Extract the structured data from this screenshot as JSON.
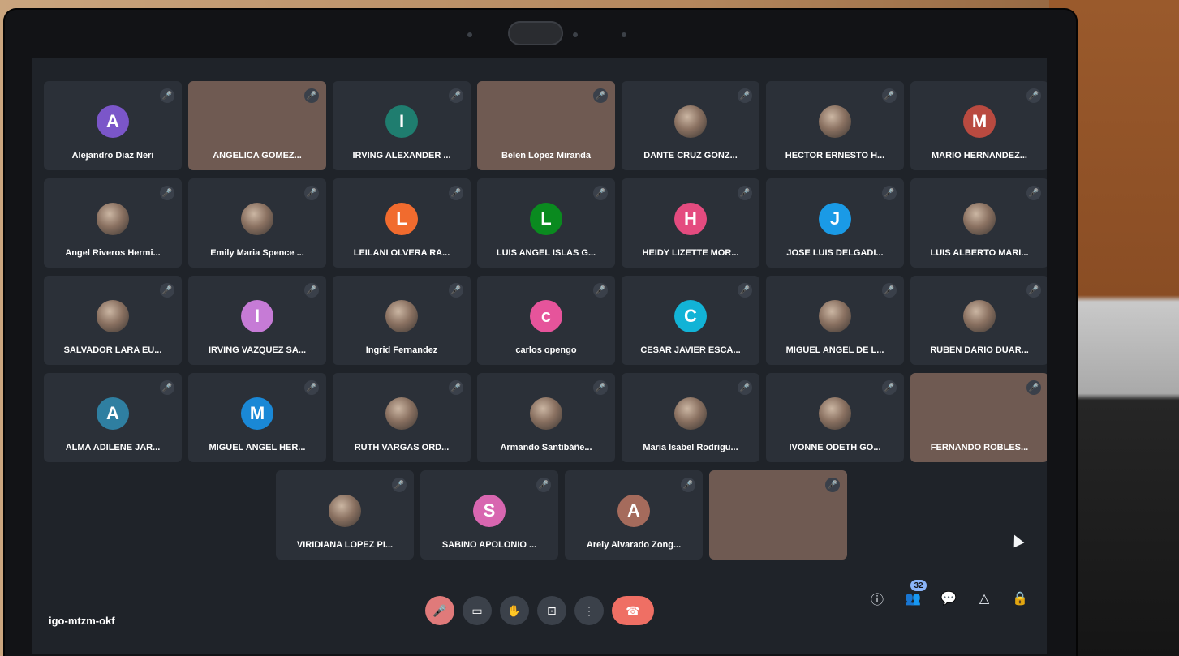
{
  "meeting": {
    "code": "igo-mtzm-okf",
    "participant_count": "32"
  },
  "tiles": [
    {
      "name": "Alejandro Diaz Neri",
      "initial": "A",
      "color": "#7b56c9",
      "kind": "initial"
    },
    {
      "name": "ANGELICA GOMEZ...",
      "initial": "",
      "color": "",
      "kind": "video"
    },
    {
      "name": "IRVING ALEXANDER ...",
      "initial": "I",
      "color": "#1f7d6f",
      "kind": "initial"
    },
    {
      "name": "Belen López Miranda",
      "initial": "",
      "color": "",
      "kind": "video"
    },
    {
      "name": "DANTE CRUZ GONZ...",
      "initial": "",
      "color": "",
      "kind": "photo"
    },
    {
      "name": "HECTOR ERNESTO H...",
      "initial": "",
      "color": "",
      "kind": "photo"
    },
    {
      "name": "MARIO HERNANDEZ...",
      "initial": "M",
      "color": "#b94a40",
      "kind": "initial"
    },
    {
      "name": "Angel Riveros Hermi...",
      "initial": "",
      "color": "",
      "kind": "photo"
    },
    {
      "name": "Emily Maria Spence ...",
      "initial": "",
      "color": "",
      "kind": "photo"
    },
    {
      "name": "LEILANI OLVERA RA...",
      "initial": "L",
      "color": "#f16b2e",
      "kind": "initial"
    },
    {
      "name": "LUIS ANGEL ISLAS G...",
      "initial": "L",
      "color": "#0a8a1f",
      "kind": "initial"
    },
    {
      "name": "HEIDY LIZETTE MOR...",
      "initial": "H",
      "color": "#e44b7f",
      "kind": "initial"
    },
    {
      "name": "JOSE LUIS DELGADI...",
      "initial": "J",
      "color": "#1a9ae6",
      "kind": "initial"
    },
    {
      "name": "LUIS ALBERTO MARI...",
      "initial": "",
      "color": "",
      "kind": "photo"
    },
    {
      "name": "SALVADOR LARA EU...",
      "initial": "",
      "color": "",
      "kind": "photo"
    },
    {
      "name": "IRVING VAZQUEZ SA...",
      "initial": "I",
      "color": "#c67bd6",
      "kind": "initial"
    },
    {
      "name": "Ingrid Fernandez",
      "initial": "",
      "color": "",
      "kind": "photo"
    },
    {
      "name": "carlos opengo",
      "initial": "c",
      "color": "#e6549b",
      "kind": "initial"
    },
    {
      "name": "CESAR JAVIER ESCA...",
      "initial": "C",
      "color": "#12b3d6",
      "kind": "initial"
    },
    {
      "name": "MIGUEL ANGEL DE L...",
      "initial": "",
      "color": "",
      "kind": "photo"
    },
    {
      "name": "RUBEN DARIO DUAR...",
      "initial": "",
      "color": "",
      "kind": "photo"
    },
    {
      "name": "ALMA ADILENE JAR...",
      "initial": "A",
      "color": "#2f7fa1",
      "kind": "initial"
    },
    {
      "name": "MIGUEL ANGEL HER...",
      "initial": "M",
      "color": "#1a88d6",
      "kind": "initial"
    },
    {
      "name": "RUTH VARGAS ORD...",
      "initial": "",
      "color": "",
      "kind": "photo"
    },
    {
      "name": "Armando Santibáñe...",
      "initial": "",
      "color": "",
      "kind": "photo"
    },
    {
      "name": "Maria Isabel Rodrigu...",
      "initial": "",
      "color": "",
      "kind": "photo"
    },
    {
      "name": "IVONNE ODETH GO...",
      "initial": "",
      "color": "",
      "kind": "photo"
    },
    {
      "name": "FERNANDO ROBLES...",
      "initial": "",
      "color": "",
      "kind": "video"
    },
    {
      "name": "VIRIDIANA LOPEZ PI...",
      "initial": "",
      "color": "",
      "kind": "photo"
    },
    {
      "name": "SABINO APOLONIO ...",
      "initial": "S",
      "color": "#d866b0",
      "kind": "initial"
    },
    {
      "name": "Arely Alvarado Zong...",
      "initial": "A",
      "color": "#a56b5c",
      "kind": "initial"
    },
    {
      "name": "",
      "initial": "",
      "color": "",
      "kind": "video"
    }
  ],
  "controls": [
    {
      "icon": "mic-off-icon"
    },
    {
      "icon": "camera-icon"
    },
    {
      "icon": "raise-hand-icon"
    },
    {
      "icon": "present-screen-icon"
    },
    {
      "icon": "more-options-icon"
    },
    {
      "icon": "hangup-icon"
    }
  ],
  "right_panel": [
    {
      "icon": "info-icon"
    },
    {
      "icon": "people-icon"
    },
    {
      "icon": "chat-icon"
    },
    {
      "icon": "activities-icon"
    },
    {
      "icon": "lock-icon"
    }
  ]
}
